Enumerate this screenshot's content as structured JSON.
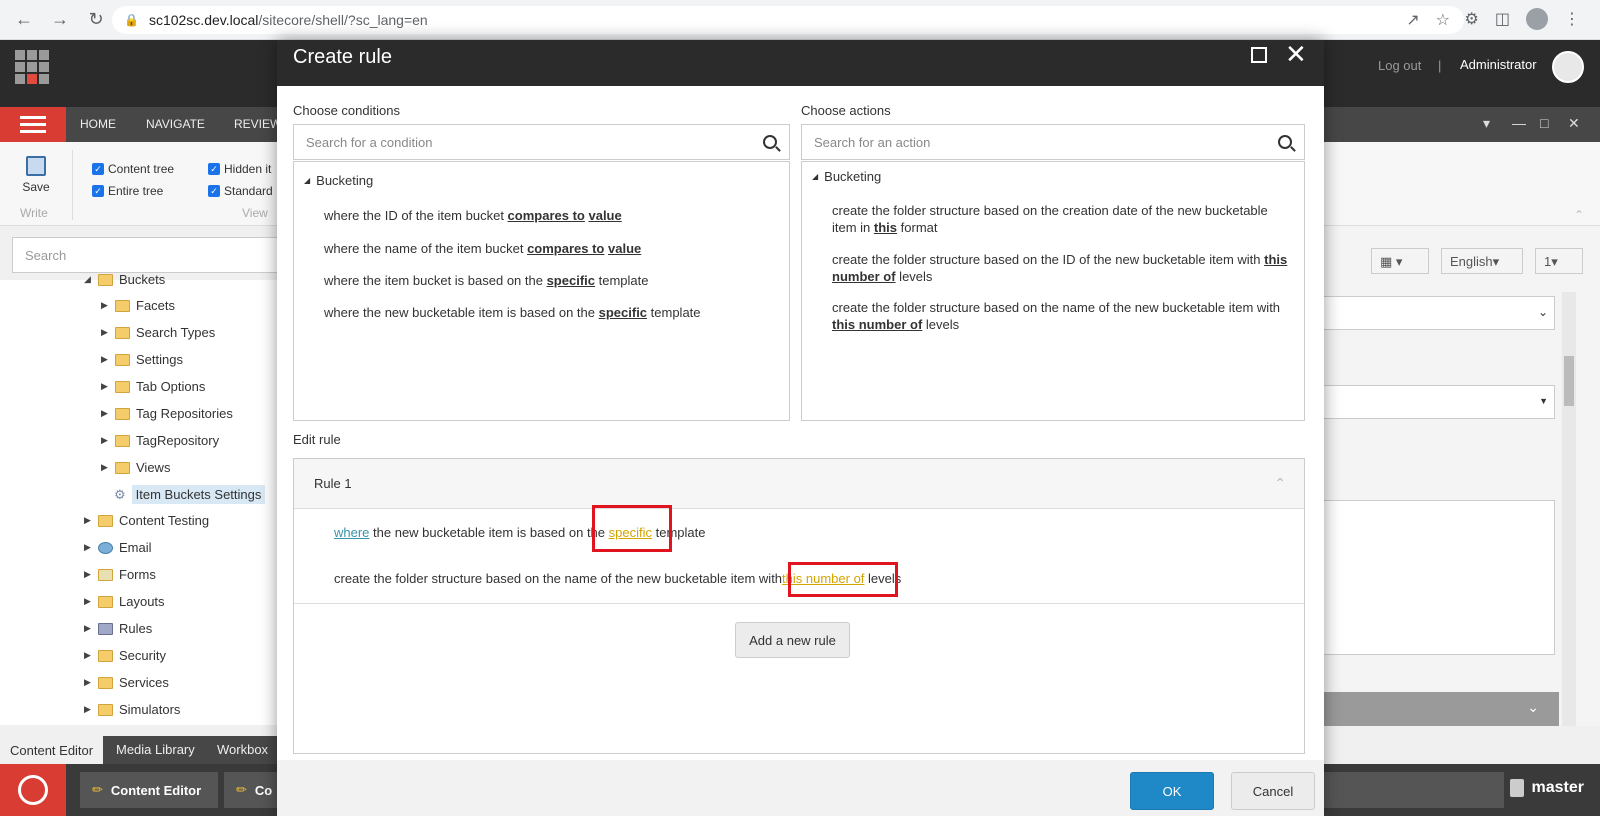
{
  "browser": {
    "url_host": "sc102sc.dev.local",
    "url_path": "/sitecore/shell/?sc_lang=en"
  },
  "header": {
    "logout": "Log out",
    "separator": "|",
    "user": "Administrator"
  },
  "ribbon": {
    "tabs": [
      "HOME",
      "NAVIGATE",
      "REVIEW"
    ],
    "save_label": "Save",
    "write_group": "Write",
    "view_group": "View",
    "checkboxes": [
      "Content tree",
      "Entire tree",
      "Hidden it",
      "Standard"
    ]
  },
  "left": {
    "search_placeholder": "Search",
    "tree": {
      "partial_top": "Buckets",
      "items": [
        "Facets",
        "Search Types",
        "Settings",
        "Tab Options",
        "Tag Repositories",
        "TagRepository",
        "Views"
      ],
      "selected": "Item Buckets Settings",
      "root_items": [
        "Content Testing",
        "Email",
        "Forms",
        "Layouts",
        "Rules",
        "Security",
        "Services",
        "Simulators"
      ]
    }
  },
  "right": {
    "language": "English",
    "version": "1"
  },
  "bottom_tabs": [
    "Content Editor",
    "Media Library",
    "Workbox"
  ],
  "taskbar": {
    "items": [
      "Content Editor",
      "Co"
    ],
    "database": "master"
  },
  "modal": {
    "title": "Create rule",
    "conditions": {
      "label": "Choose conditions",
      "placeholder": "Search for a condition",
      "group": "Bucketing",
      "items": [
        {
          "pre": "where the ID of the item bucket ",
          "k1": "compares to",
          "mid": " ",
          "k2": "value",
          "post": ""
        },
        {
          "pre": "where the name of the item bucket ",
          "k1": "compares to",
          "mid": " ",
          "k2": "value",
          "post": ""
        },
        {
          "pre": "where the item bucket is based on the ",
          "k1": "specific",
          "mid": " template",
          "k2": "",
          "post": ""
        },
        {
          "pre": "where the new bucketable item is based on the ",
          "k1": "specific",
          "mid": " template",
          "k2": "",
          "post": ""
        }
      ]
    },
    "actions": {
      "label": "Choose actions",
      "placeholder": "Search for an action",
      "group": "Bucketing",
      "items": [
        {
          "l1": "create the folder structure based on the creation date of the new bucketable",
          "l2pre": "item in ",
          "l2k": "this",
          "l2post": " format"
        },
        {
          "l1pre": "create the folder structure based on the ID of the new bucketable item with ",
          "l1k": "this",
          "l2k": "number of",
          "l2post": " levels"
        },
        {
          "l1": "create the folder structure based on the name of the new bucketable item with",
          "l2k": "this number of",
          "l2post": " levels"
        }
      ]
    },
    "edit": {
      "label": "Edit rule",
      "rule_title": "Rule 1",
      "line1": {
        "where": "where",
        "pre": " the new bucketable item is based on the ",
        "kw": "specific",
        "post": " template"
      },
      "line2": {
        "pre": "create the folder structure based on the name of the new bucketable item with",
        "kw": "this number of",
        "post": " levels"
      },
      "add_rule": "Add a new rule"
    },
    "ok": "OK",
    "cancel": "Cancel"
  }
}
